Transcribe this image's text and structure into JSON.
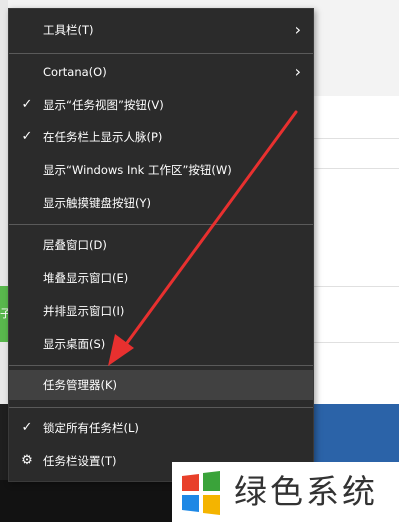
{
  "menu": {
    "items": [
      {
        "label": "工具栏(T)",
        "check": false,
        "submenu": true
      },
      {
        "label": "Cortana(O)",
        "check": false,
        "submenu": true
      },
      {
        "label": "显示“任务视图”按钮(V)",
        "check": true,
        "submenu": false
      },
      {
        "label": "在任务栏上显示人脉(P)",
        "check": true,
        "submenu": false
      },
      {
        "label": "显示“Windows Ink 工作区”按钮(W)",
        "check": false,
        "submenu": false
      },
      {
        "label": "显示触摸键盘按钮(Y)",
        "check": false,
        "submenu": false
      },
      {
        "label": "层叠窗口(D)",
        "check": false,
        "submenu": false
      },
      {
        "label": "堆叠显示窗口(E)",
        "check": false,
        "submenu": false
      },
      {
        "label": "并排显示窗口(I)",
        "check": false,
        "submenu": false
      },
      {
        "label": "显示桌面(S)",
        "check": false,
        "submenu": false
      },
      {
        "label": "任务管理器(K)",
        "check": false,
        "submenu": false,
        "highlighted": true
      },
      {
        "label": "锁定所有任务栏(L)",
        "check": true,
        "submenu": false
      },
      {
        "label": "任务栏设置(T)",
        "icon": "gear-icon",
        "submenu": false
      }
    ],
    "check_glyph": "✓",
    "arrow_glyph": "›",
    "gear_glyph": "⚙",
    "colors": {
      "background": "#2b2b2b",
      "highlight": "#414141",
      "text": "#ffffff",
      "separator": "#5a5a5a"
    }
  },
  "background": {
    "green_tab_char": "子",
    "colors": {
      "accent_blue": "#2b63a8",
      "accent_green": "#59b84d",
      "taskbar": "#121212"
    }
  },
  "annotation": {
    "type": "arrow",
    "color": "#e8302f"
  },
  "watermark": {
    "text": "绿色系统",
    "logo": "windows-logo-icon",
    "logo_colors": [
      "#e8402a",
      "#3aa33a",
      "#1e88e5",
      "#f4b400"
    ]
  }
}
